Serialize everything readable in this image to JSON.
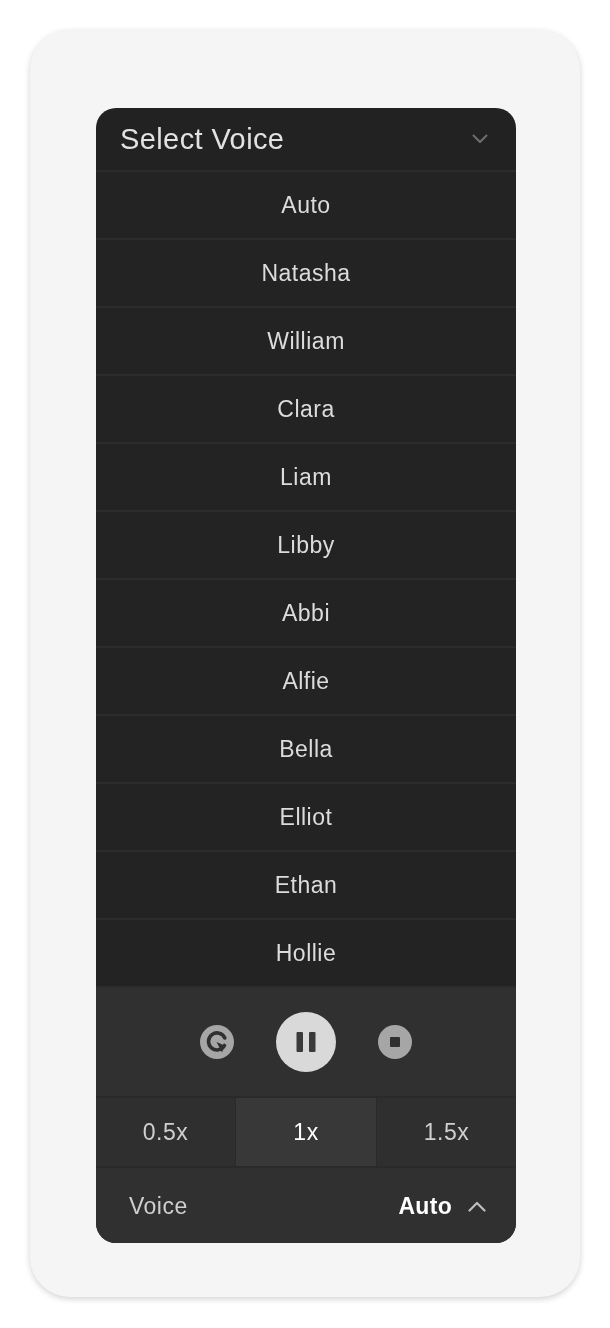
{
  "header": {
    "title": "Select Voice"
  },
  "voices": [
    {
      "name": "Auto"
    },
    {
      "name": "Natasha"
    },
    {
      "name": "William"
    },
    {
      "name": "Clara"
    },
    {
      "name": "Liam"
    },
    {
      "name": "Libby"
    },
    {
      "name": "Abbi"
    },
    {
      "name": "Alfie"
    },
    {
      "name": "Bella"
    },
    {
      "name": "Elliot"
    },
    {
      "name": "Ethan"
    },
    {
      "name": "Hollie"
    }
  ],
  "speeds": [
    {
      "label": "0.5x",
      "selected": false
    },
    {
      "label": "1x",
      "selected": true
    },
    {
      "label": "1.5x",
      "selected": false
    }
  ],
  "footer": {
    "label": "Voice",
    "value": "Auto"
  }
}
